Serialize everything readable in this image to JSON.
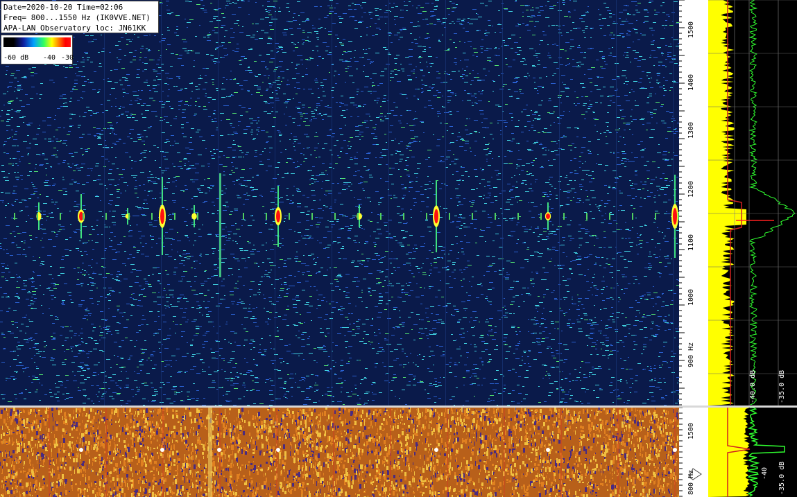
{
  "info": {
    "line1": "Date=2020-10-20 Time=02:06",
    "line2": "Freq= 800...1550 Hz (IK0VVE.NET)",
    "line3": "APA-LAN Observatory loc: JN61KK"
  },
  "legend": {
    "min_label": "-60 dB",
    "mid_label": "-40",
    "max_label": "-30"
  },
  "freq_scale": {
    "ticks": [
      "1500",
      "1400",
      "1300",
      "1200",
      "1100",
      "1000",
      "900 Hz"
    ]
  },
  "freq_scale_bottom": {
    "ticks": [
      "1500",
      "800 Hz"
    ]
  },
  "spectrum_labels": {
    "top": [
      "dB",
      "-40.0 dB",
      "-35.0 dB"
    ],
    "bottom": [
      "-40",
      "-35.0 dB"
    ]
  },
  "colors": {
    "waterfall_bg": "#0a1a4a",
    "speckle_cyan": "#3fd0e0",
    "speckle_blue": "#2a60d0",
    "signal_red": "#ff1010",
    "signal_yellow": "#ffff30",
    "avg_yellow": "#ffff00",
    "peak_green": "#30ff30",
    "bottom_bg": "#b8601a"
  }
}
